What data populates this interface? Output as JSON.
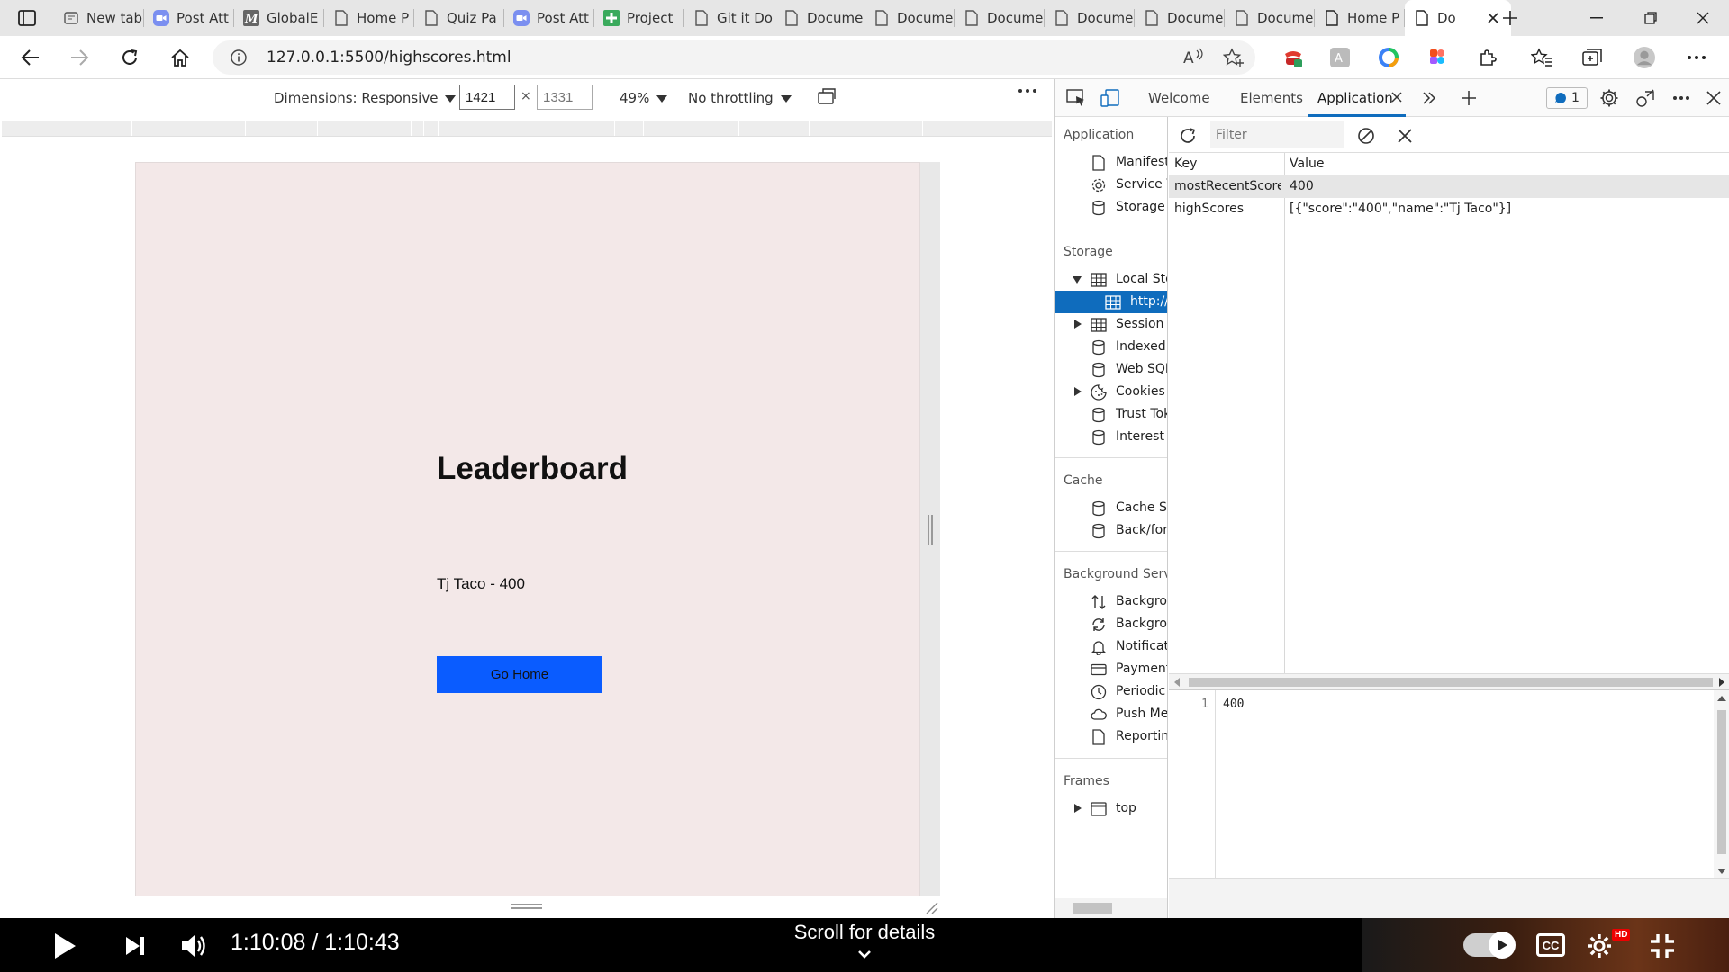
{
  "browser": {
    "tabs": [
      {
        "label": "",
        "icon": "tab-actions-icon"
      },
      {
        "label": "New tab",
        "icon": "newtab-icon"
      },
      {
        "label": "Post Att",
        "icon": "zoom-icon"
      },
      {
        "label": "GlobalE",
        "icon": "m-logo-icon"
      },
      {
        "label": "Home P",
        "icon": "page-icon"
      },
      {
        "label": "Quiz Pa",
        "icon": "page-icon"
      },
      {
        "label": "Post Att",
        "icon": "zoom-icon"
      },
      {
        "label": "Project",
        "icon": "plus-sheet-icon"
      },
      {
        "label": "Git it Do",
        "icon": "page-icon"
      },
      {
        "label": "Docume",
        "icon": "page-icon"
      },
      {
        "label": "Docume",
        "icon": "page-icon"
      },
      {
        "label": "Docume",
        "icon": "page-icon"
      },
      {
        "label": "Docume",
        "icon": "page-icon"
      },
      {
        "label": "Docume",
        "icon": "page-icon"
      },
      {
        "label": "Docume",
        "icon": "page-icon"
      },
      {
        "label": "Home P",
        "icon": "page-icon"
      },
      {
        "label": "Do",
        "icon": "page-icon",
        "active": true
      }
    ],
    "url": "127.0.0.1:5500/highscores.html"
  },
  "device_toolbar": {
    "dimensions_label": "Dimensions: Responsive",
    "width_value": "1421",
    "height_placeholder": "1331",
    "times": "×",
    "zoom": "49%",
    "throttling": "No throttling"
  },
  "page": {
    "title": "Leaderboard",
    "entry": "Tj Taco - 400",
    "go_home": "Go Home"
  },
  "devtools": {
    "tabs": {
      "welcome": "Welcome",
      "elements": "Elements",
      "application": "Application"
    },
    "issues_count": "1",
    "sidebar": {
      "application_heading": "Application",
      "application_items": [
        "Manifest",
        "Service V",
        "Storage"
      ],
      "storage_heading": "Storage",
      "storage_items": [
        "Local Sto",
        "http://",
        "Session S",
        "IndexedI",
        "Web SQL",
        "Cookies",
        "Trust Tok",
        "Interest ("
      ],
      "cache_heading": "Cache",
      "cache_items": [
        "Cache St",
        "Back/for"
      ],
      "background_heading": "Background Servi",
      "background_items": [
        "Backgrou",
        "Backgrou",
        "Notificat",
        "Payment",
        "Periodic",
        "Push Me",
        "Reportin"
      ],
      "frames_heading": "Frames",
      "frames_items": [
        "top"
      ]
    },
    "storage_table": {
      "filter_placeholder": "Filter",
      "key_header": "Key",
      "value_header": "Value",
      "rows": [
        {
          "key": "mostRecentScore",
          "value": "400",
          "selected": true
        },
        {
          "key": "highScores",
          "value": "[{\"score\":\"400\",\"name\":\"Tj Taco\"}]"
        }
      ]
    },
    "preview": {
      "line_number": "1",
      "content": "400"
    }
  },
  "video": {
    "time": "1:10:08 / 1:10:43",
    "details": "Scroll for details",
    "cc": "CC",
    "hd": "HD"
  }
}
